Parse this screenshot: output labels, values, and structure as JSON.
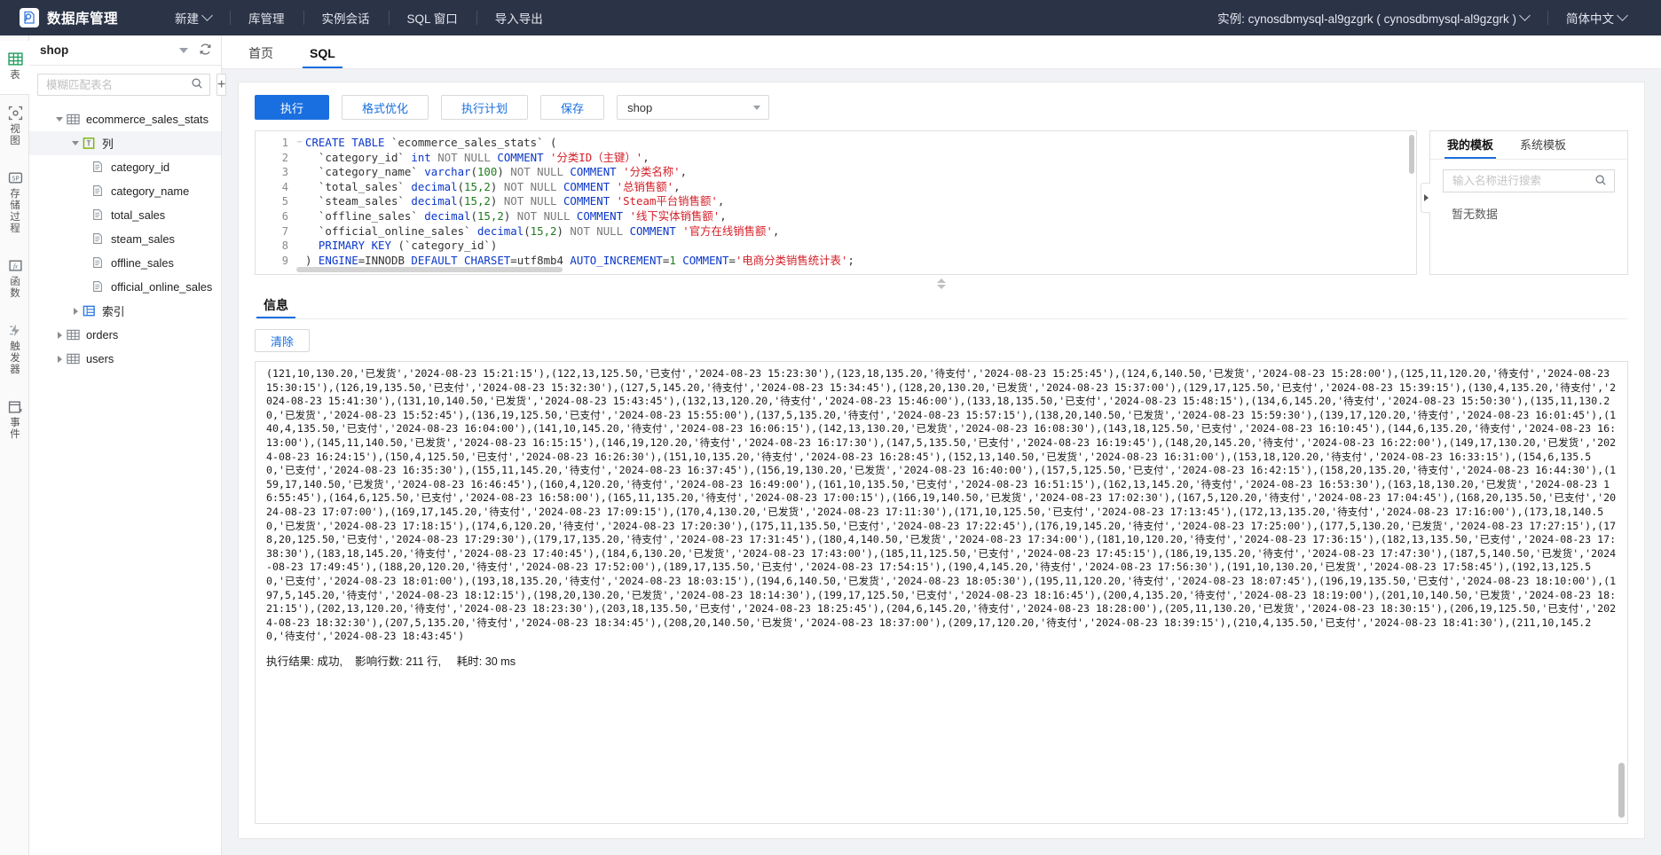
{
  "header": {
    "brand_title": "数据库管理",
    "logo_icon": "database-logo-icon",
    "nav": [
      {
        "label": "新建",
        "icon": "chevron-down-icon",
        "has_caret": true
      },
      {
        "label": "库管理",
        "has_caret": false
      },
      {
        "label": "实例会话",
        "has_caret": false
      },
      {
        "label": "SQL 窗口",
        "has_caret": false
      },
      {
        "label": "导入导出",
        "has_caret": false
      }
    ],
    "instance_label": "实例: cynosdbmysql-al9gzgrk ( cynosdbmysql-al9gzgrk )",
    "language_label": "简体中文"
  },
  "rail": {
    "items": [
      {
        "label": "表",
        "icon": "table-icon",
        "active": true
      },
      {
        "label": "视图",
        "icon": "view-icon",
        "active": false
      },
      {
        "label": "存储过程",
        "icon": "stored-procedure-icon",
        "active": false
      },
      {
        "label": "函数",
        "icon": "function-fx-icon",
        "active": false
      },
      {
        "label": "触发器",
        "icon": "trigger-icon",
        "active": false
      },
      {
        "label": "事件",
        "icon": "event-calendar-icon",
        "active": false
      }
    ]
  },
  "sidebar": {
    "database_name": "shop",
    "search_placeholder": "模糊匹配表名",
    "search_value": "",
    "search_icon": "search-icon",
    "add_icon": "plus-icon",
    "refresh_icon": "refresh-icon",
    "tree": [
      {
        "label": "ecommerce_sales_stats",
        "depth": 1,
        "twisty": "down",
        "icon": "table-icon",
        "selected": false
      },
      {
        "label": "列",
        "depth": 2,
        "twisty": "down",
        "icon": "column-icon",
        "selected": true
      },
      {
        "label": "category_id",
        "depth": 3,
        "twisty": "none",
        "icon": "field-icon",
        "selected": false
      },
      {
        "label": "category_name",
        "depth": 3,
        "twisty": "none",
        "icon": "field-icon",
        "selected": false
      },
      {
        "label": "total_sales",
        "depth": 3,
        "twisty": "none",
        "icon": "field-icon",
        "selected": false
      },
      {
        "label": "steam_sales",
        "depth": 3,
        "twisty": "none",
        "icon": "field-icon",
        "selected": false
      },
      {
        "label": "offline_sales",
        "depth": 3,
        "twisty": "none",
        "icon": "field-icon",
        "selected": false
      },
      {
        "label": "official_online_sales",
        "depth": 3,
        "twisty": "none",
        "icon": "field-icon",
        "selected": false
      },
      {
        "label": "索引",
        "depth": 2,
        "twisty": "right",
        "icon": "index-icon",
        "selected": false
      },
      {
        "label": "orders",
        "depth": 1,
        "twisty": "right",
        "icon": "table-icon",
        "selected": false
      },
      {
        "label": "users",
        "depth": 1,
        "twisty": "right",
        "icon": "table-icon",
        "selected": false
      }
    ]
  },
  "main": {
    "tabs": [
      {
        "label": "首页",
        "active": false
      },
      {
        "label": "SQL",
        "active": true
      }
    ],
    "toolbar": {
      "execute_label": "执行",
      "format_label": "格式优化",
      "plan_label": "执行计划",
      "save_label": "保存",
      "db_select_value": "shop"
    },
    "editor": {
      "lines": [
        {
          "n": "1",
          "fold": "−",
          "tokens": [
            {
              "t": "CREATE TABLE ",
              "c": "kw"
            },
            {
              "t": "`ecommerce_sales_stats` (",
              "c": "punc"
            }
          ]
        },
        {
          "n": "2",
          "fold": "",
          "tokens": [
            {
              "t": "  `category_id` ",
              "c": "punc"
            },
            {
              "t": "int",
              "c": "kw"
            },
            {
              "t": " NOT NULL ",
              "c": "kw2"
            },
            {
              "t": "COMMENT ",
              "c": "kw"
            },
            {
              "t": "'分类ID（主键）'",
              "c": "str"
            },
            {
              "t": ",",
              "c": "punc"
            }
          ]
        },
        {
          "n": "3",
          "fold": "",
          "tokens": [
            {
              "t": "  `category_name` ",
              "c": "punc"
            },
            {
              "t": "varchar",
              "c": "kw"
            },
            {
              "t": "(",
              "c": "punc"
            },
            {
              "t": "100",
              "c": "num"
            },
            {
              "t": ") ",
              "c": "punc"
            },
            {
              "t": "NOT NULL ",
              "c": "kw2"
            },
            {
              "t": "COMMENT ",
              "c": "kw"
            },
            {
              "t": "'分类名称'",
              "c": "str"
            },
            {
              "t": ",",
              "c": "punc"
            }
          ]
        },
        {
          "n": "4",
          "fold": "",
          "tokens": [
            {
              "t": "  `total_sales` ",
              "c": "punc"
            },
            {
              "t": "decimal",
              "c": "kw"
            },
            {
              "t": "(",
              "c": "punc"
            },
            {
              "t": "15,2",
              "c": "num"
            },
            {
              "t": ") ",
              "c": "punc"
            },
            {
              "t": "NOT NULL ",
              "c": "kw2"
            },
            {
              "t": "COMMENT ",
              "c": "kw"
            },
            {
              "t": "'总销售额'",
              "c": "str"
            },
            {
              "t": ",",
              "c": "punc"
            }
          ]
        },
        {
          "n": "5",
          "fold": "",
          "tokens": [
            {
              "t": "  `steam_sales` ",
              "c": "punc"
            },
            {
              "t": "decimal",
              "c": "kw"
            },
            {
              "t": "(",
              "c": "punc"
            },
            {
              "t": "15,2",
              "c": "num"
            },
            {
              "t": ") ",
              "c": "punc"
            },
            {
              "t": "NOT NULL ",
              "c": "kw2"
            },
            {
              "t": "COMMENT ",
              "c": "kw"
            },
            {
              "t": "'Steam平台销售额'",
              "c": "str"
            },
            {
              "t": ",",
              "c": "punc"
            }
          ]
        },
        {
          "n": "6",
          "fold": "",
          "tokens": [
            {
              "t": "  `offline_sales` ",
              "c": "punc"
            },
            {
              "t": "decimal",
              "c": "kw"
            },
            {
              "t": "(",
              "c": "punc"
            },
            {
              "t": "15,2",
              "c": "num"
            },
            {
              "t": ") ",
              "c": "punc"
            },
            {
              "t": "NOT NULL ",
              "c": "kw2"
            },
            {
              "t": "COMMENT ",
              "c": "kw"
            },
            {
              "t": "'线下实体销售额'",
              "c": "str"
            },
            {
              "t": ",",
              "c": "punc"
            }
          ]
        },
        {
          "n": "7",
          "fold": "",
          "tokens": [
            {
              "t": "  `official_online_sales` ",
              "c": "punc"
            },
            {
              "t": "decimal",
              "c": "kw"
            },
            {
              "t": "(",
              "c": "punc"
            },
            {
              "t": "15,2",
              "c": "num"
            },
            {
              "t": ") ",
              "c": "punc"
            },
            {
              "t": "NOT NULL ",
              "c": "kw2"
            },
            {
              "t": "COMMENT ",
              "c": "kw"
            },
            {
              "t": "'官方在线销售额'",
              "c": "str"
            },
            {
              "t": ",",
              "c": "punc"
            }
          ]
        },
        {
          "n": "8",
          "fold": "",
          "tokens": [
            {
              "t": "  PRIMARY KEY ",
              "c": "kw"
            },
            {
              "t": "(`category_id`)",
              "c": "punc"
            }
          ]
        },
        {
          "n": "9",
          "fold": "",
          "tokens": [
            {
              "t": ") ",
              "c": "punc"
            },
            {
              "t": "ENGINE",
              "c": "kw"
            },
            {
              "t": "=INNODB ",
              "c": "punc"
            },
            {
              "t": "DEFAULT CHARSET",
              "c": "kw"
            },
            {
              "t": "=utf8mb4 ",
              "c": "punc"
            },
            {
              "t": "AUTO_INCREMENT",
              "c": "kw"
            },
            {
              "t": "=",
              "c": "punc"
            },
            {
              "t": "1",
              "c": "num"
            },
            {
              "t": " COMMENT",
              "c": "kw"
            },
            {
              "t": "=",
              "c": "punc"
            },
            {
              "t": "'电商分类销售统计表'",
              "c": "str"
            },
            {
              "t": ";",
              "c": "punc"
            }
          ]
        }
      ]
    },
    "templates": {
      "tabs": [
        {
          "label": "我的模板",
          "active": true
        },
        {
          "label": "系统模板",
          "active": false
        }
      ],
      "search_placeholder": "输入名称进行搜索",
      "search_value": "",
      "search_icon": "search-icon",
      "empty_text": "暂无数据",
      "collapse_icon": "collapse-right-icon"
    },
    "info": {
      "tab_label": "信息",
      "clear_label": "清除",
      "log": "(121,10,130.20,'已发货','2024-08-23 15:21:15'),(122,13,125.50,'已支付','2024-08-23 15:23:30'),(123,18,135.20,'待支付','2024-08-23 15:25:45'),(124,6,140.50,'已发货','2024-08-23 15:28:00'),(125,11,120.20,'待支付','2024-08-23 15:30:15'),(126,19,135.50,'已支付','2024-08-23 15:32:30'),(127,5,145.20,'待支付','2024-08-23 15:34:45'),(128,20,130.20,'已发货','2024-08-23 15:37:00'),(129,17,125.50,'已支付','2024-08-23 15:39:15'),(130,4,135.20,'待支付','2024-08-23 15:41:30'),(131,10,140.50,'已发货','2024-08-23 15:43:45'),(132,13,120.20,'待支付','2024-08-23 15:46:00'),(133,18,135.50,'已支付','2024-08-23 15:48:15'),(134,6,145.20,'待支付','2024-08-23 15:50:30'),(135,11,130.20,'已发货','2024-08-23 15:52:45'),(136,19,125.50,'已支付','2024-08-23 15:55:00'),(137,5,135.20,'待支付','2024-08-23 15:57:15'),(138,20,140.50,'已发货','2024-08-23 15:59:30'),(139,17,120.20,'待支付','2024-08-23 16:01:45'),(140,4,135.50,'已支付','2024-08-23 16:04:00'),(141,10,145.20,'待支付','2024-08-23 16:06:15'),(142,13,130.20,'已发货','2024-08-23 16:08:30'),(143,18,125.50,'已支付','2024-08-23 16:10:45'),(144,6,135.20,'待支付','2024-08-23 16:13:00'),(145,11,140.50,'已发货','2024-08-23 16:15:15'),(146,19,120.20,'待支付','2024-08-23 16:17:30'),(147,5,135.50,'已支付','2024-08-23 16:19:45'),(148,20,145.20,'待支付','2024-08-23 16:22:00'),(149,17,130.20,'已发货','2024-08-23 16:24:15'),(150,4,125.50,'已支付','2024-08-23 16:26:30'),(151,10,135.20,'待支付','2024-08-23 16:28:45'),(152,13,140.50,'已发货','2024-08-23 16:31:00'),(153,18,120.20,'待支付','2024-08-23 16:33:15'),(154,6,135.50,'已支付','2024-08-23 16:35:30'),(155,11,145.20,'待支付','2024-08-23 16:37:45'),(156,19,130.20,'已发货','2024-08-23 16:40:00'),(157,5,125.50,'已支付','2024-08-23 16:42:15'),(158,20,135.20,'待支付','2024-08-23 16:44:30'),(159,17,140.50,'已发货','2024-08-23 16:46:45'),(160,4,120.20,'待支付','2024-08-23 16:49:00'),(161,10,135.50,'已支付','2024-08-23 16:51:15'),(162,13,145.20,'待支付','2024-08-23 16:53:30'),(163,18,130.20,'已发货','2024-08-23 16:55:45'),(164,6,125.50,'已支付','2024-08-23 16:58:00'),(165,11,135.20,'待支付','2024-08-23 17:00:15'),(166,19,140.50,'已发货','2024-08-23 17:02:30'),(167,5,120.20,'待支付','2024-08-23 17:04:45'),(168,20,135.50,'已支付','2024-08-23 17:07:00'),(169,17,145.20,'待支付','2024-08-23 17:09:15'),(170,4,130.20,'已发货','2024-08-23 17:11:30'),(171,10,125.50,'已支付','2024-08-23 17:13:45'),(172,13,135.20,'待支付','2024-08-23 17:16:00'),(173,18,140.50,'已发货','2024-08-23 17:18:15'),(174,6,120.20,'待支付','2024-08-23 17:20:30'),(175,11,135.50,'已支付','2024-08-23 17:22:45'),(176,19,145.20,'待支付','2024-08-23 17:25:00'),(177,5,130.20,'已发货','2024-08-23 17:27:15'),(178,20,125.50,'已支付','2024-08-23 17:29:30'),(179,17,135.20,'待支付','2024-08-23 17:31:45'),(180,4,140.50,'已发货','2024-08-23 17:34:00'),(181,10,120.20,'待支付','2024-08-23 17:36:15'),(182,13,135.50,'已支付','2024-08-23 17:38:30'),(183,18,145.20,'待支付','2024-08-23 17:40:45'),(184,6,130.20,'已发货','2024-08-23 17:43:00'),(185,11,125.50,'已支付','2024-08-23 17:45:15'),(186,19,135.20,'待支付','2024-08-23 17:47:30'),(187,5,140.50,'已发货','2024-08-23 17:49:45'),(188,20,120.20,'待支付','2024-08-23 17:52:00'),(189,17,135.50,'已支付','2024-08-23 17:54:15'),(190,4,145.20,'待支付','2024-08-23 17:56:30'),(191,10,130.20,'已发货','2024-08-23 17:58:45'),(192,13,125.50,'已支付','2024-08-23 18:01:00'),(193,18,135.20,'待支付','2024-08-23 18:03:15'),(194,6,140.50,'已发货','2024-08-23 18:05:30'),(195,11,120.20,'待支付','2024-08-23 18:07:45'),(196,19,135.50,'已支付','2024-08-23 18:10:00'),(197,5,145.20,'待支付','2024-08-23 18:12:15'),(198,20,130.20,'已发货','2024-08-23 18:14:30'),(199,17,125.50,'已支付','2024-08-23 18:16:45'),(200,4,135.20,'待支付','2024-08-23 18:19:00'),(201,10,140.50,'已发货','2024-08-23 18:21:15'),(202,13,120.20,'待支付','2024-08-23 18:23:30'),(203,18,135.50,'已支付','2024-08-23 18:25:45'),(204,6,145.20,'待支付','2024-08-23 18:28:00'),(205,11,130.20,'已发货','2024-08-23 18:30:15'),(206,19,125.50,'已支付','2024-08-23 18:32:30'),(207,5,135.20,'待支付','2024-08-23 18:34:45'),(208,20,140.50,'已发货','2024-08-23 18:37:00'),(209,17,120.20,'待支付','2024-08-23 18:39:15'),(210,4,135.50,'已支付','2024-08-23 18:41:30'),(211,10,145.20,'待支付','2024-08-23 18:43:45')",
      "summary": "执行结果: 成功,    影响行数: 211 行,     耗时: 30 ms"
    }
  }
}
